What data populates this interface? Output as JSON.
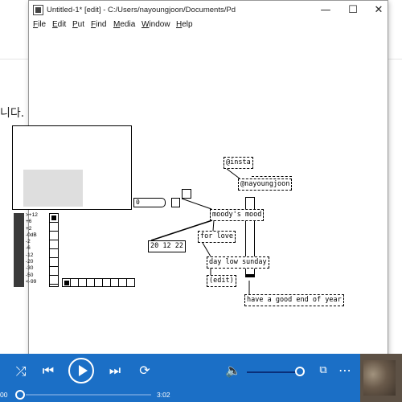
{
  "background": {
    "partial_text": "니다."
  },
  "window": {
    "title": "Untitled-1* [edit] - C:/Users/nayoungjoon/Documents/Pd",
    "controls": {
      "minimize": "—",
      "maximize": "☐",
      "close": "✕"
    },
    "menu": [
      "File",
      "Edit",
      "Put",
      "Find",
      "Media",
      "Window",
      "Help"
    ]
  },
  "patch": {
    "number_box": "0",
    "objects": {
      "insta": "@insta",
      "nayoungjoon": "@nayoungjoon",
      "moods_mood": "moody's mood",
      "list": "20 12 22",
      "for_love": "for love",
      "day_low_sunday": "day low sunday",
      "edit": "(edit)",
      "good_end": "have a good end of year"
    },
    "vu_labels": [
      ">+12",
      "+6",
      "+2",
      "-0dB",
      "-2",
      "-6",
      "-12",
      "-20",
      "-30",
      "-50",
      "<-99"
    ]
  },
  "player": {
    "time_start": "00",
    "time_end": "3:02",
    "icons": [
      "shuffle-icon",
      "previous-icon",
      "play-icon",
      "next-icon",
      "repeat-icon",
      "volume-icon",
      "miniplayer-icon",
      "more-icon"
    ]
  }
}
